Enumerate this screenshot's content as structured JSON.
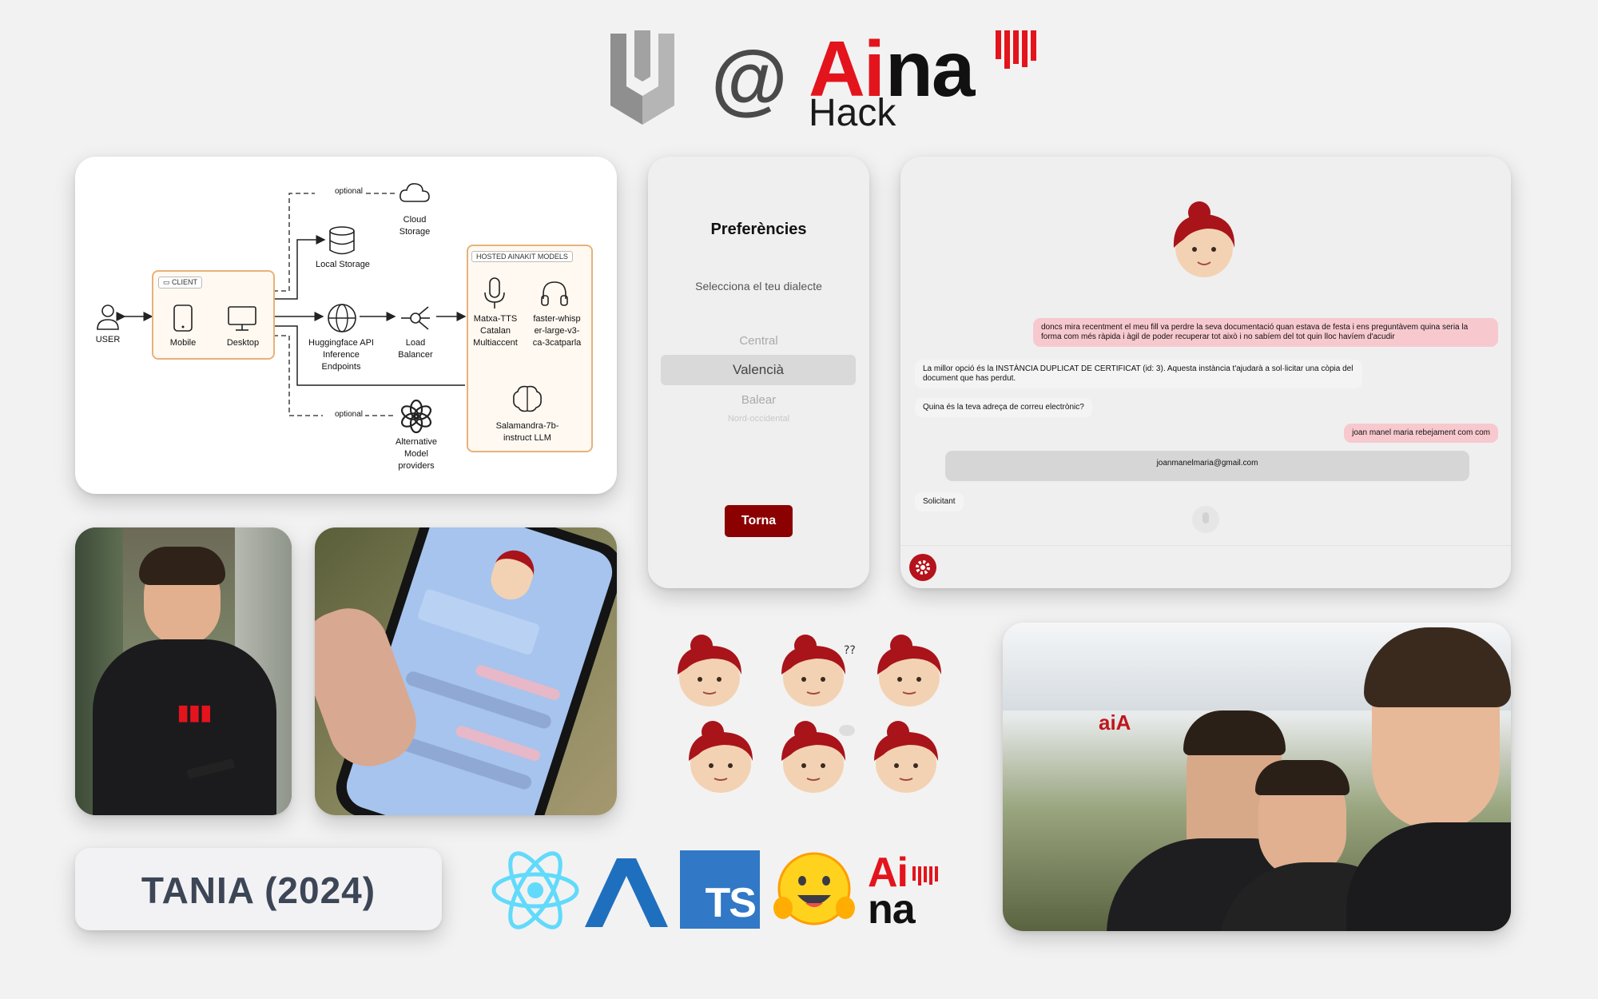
{
  "header": {
    "at": "@",
    "aina": {
      "ai": "Ai",
      "na": "na"
    },
    "hack": "Hack"
  },
  "diagram": {
    "user": "USER",
    "client_tag": "CLIENT",
    "mobile": "Mobile",
    "desktop": "Desktop",
    "optional_top": "optional",
    "optional_bottom": "optional",
    "cloud": "Cloud Storage",
    "local_storage": "Local Storage",
    "hf": "Huggingface API Inference Endpoints",
    "load_balancer": "Load Balancer",
    "alternative": "Alternative Model providers",
    "hosted_tag": "HOSTED AINAKIT MODELS",
    "tts": "Matxa-TTS Catalan Multiaccent",
    "whisper": "faster-whisper-large-v3-ca-3catparla",
    "llm": "Salamandra-7b-instruct LLM"
  },
  "preferences": {
    "title": "Preferències",
    "subtitle": "Selecciona el teu dialecte",
    "options": [
      "Central",
      "Valencià",
      "Balear",
      "Nord-occidental"
    ],
    "selected": "Valencià",
    "back_button": "Torna"
  },
  "chat": {
    "msg1": "doncs mira recentment el meu fill va perdre la seva documentació quan estava de festa i ens preguntàvem quina seria la forma com més ràpida i àgil de poder recuperar tot això i no sabíem del tot quin lloc havíem d'acudir",
    "msg2": "La millor opció és la INSTÀNCIA DUPLICAT DE CERTIFICAT (id: 3). Aquesta instància t'ajudarà a sol·licitar una còpia del document que has perdut.",
    "msg3": "Quina és la teva adreça de correu electrònic?",
    "msg4": "joan manel maria rebejament com com",
    "email_value": "joanmanelmaria@gmail.com",
    "msg5": "Solicitant"
  },
  "title_card": "TANIA (2024)",
  "tech_logos": {
    "ts": "TS",
    "aina_ai": "Ai",
    "aina_na": "na"
  },
  "colors": {
    "aina_red": "#e3141c",
    "dark_red": "#8b0000",
    "react_blue": "#61dafb",
    "ts_blue": "#3178c6",
    "amplify_blue": "#1f6fbf",
    "hf_yellow": "#ffd21e",
    "pink_bubble": "#f7c9cf",
    "background": "#f2f2f2"
  },
  "icons": [
    "univ-shield-icon",
    "user-icon",
    "mobile-icon",
    "desktop-icon",
    "cloud-icon",
    "database-icon",
    "globe-icon",
    "load-balancer-icon",
    "openai-icon",
    "microphone-icon",
    "headphones-icon",
    "brain-icon",
    "gear-icon",
    "react-icon",
    "amplify-icon",
    "huggingface-icon"
  ]
}
